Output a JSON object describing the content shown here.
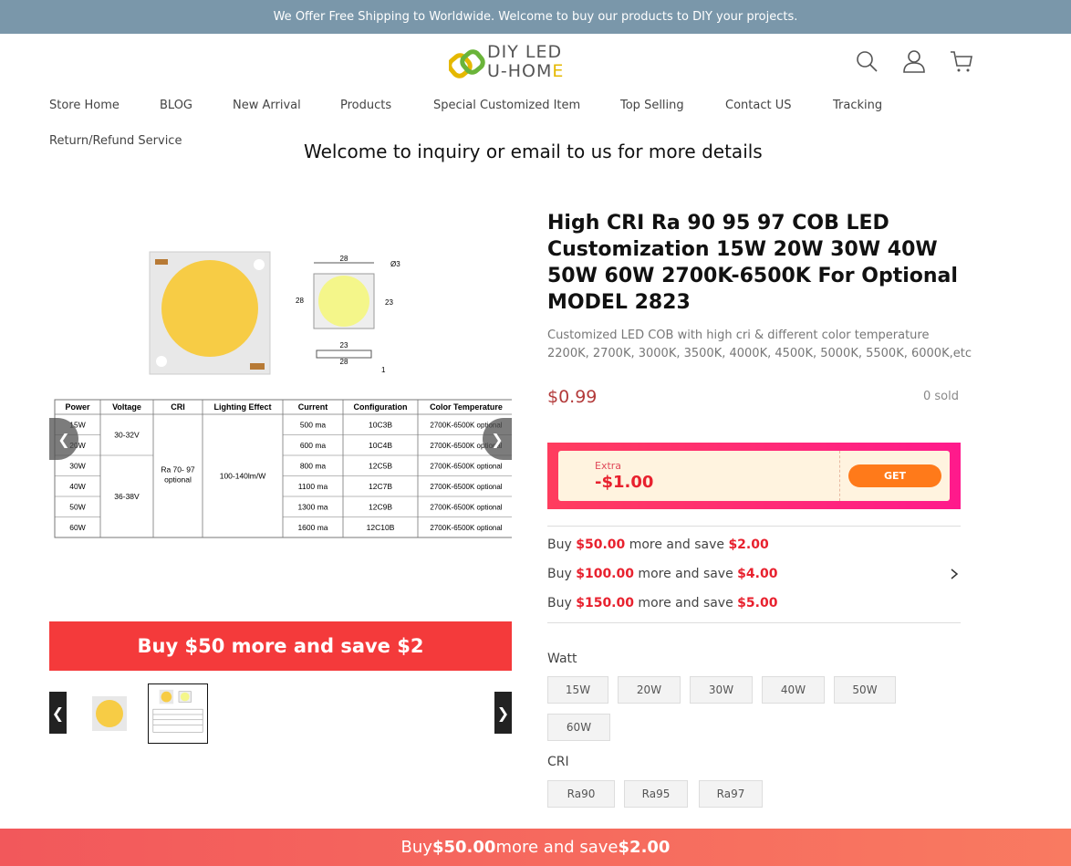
{
  "announcement": "We Offer Free Shipping to Worldwide. Welcome to buy our products to DIY your projects.",
  "logo": {
    "line1": "DIY LED",
    "line2a": "U-HOM",
    "line2b": "E"
  },
  "header_icons": [
    "search-icon",
    "user-icon",
    "cart-icon"
  ],
  "nav": {
    "items": [
      "Store Home",
      "BLOG",
      "New Arrival",
      "Products",
      "Special Customized Item",
      "Top Selling",
      "Contact US",
      "Tracking",
      "Return/Refund Service"
    ]
  },
  "welcome": "Welcome to inquiry or email to us for more details",
  "gallery": {
    "table": {
      "headers": [
        "Power",
        "Voltage",
        "CRI",
        "Lighting Effect",
        "Current",
        "Configuration",
        "Color Temperature"
      ],
      "power": [
        "15W",
        "20W",
        "30W",
        "40W",
        "50W",
        "60W"
      ],
      "voltage": [
        "30-32V",
        "36-38V"
      ],
      "cri": "Ra 70- 97 optional",
      "effect": "100-140lm/W",
      "current": [
        "500 ma",
        "600 ma",
        "800 ma",
        "1100 ma",
        "1300 ma",
        "1600 ma"
      ],
      "config": [
        "10C3B",
        "10C4B",
        "12C5B",
        "12C7B",
        "12C9B",
        "12C10B"
      ],
      "temp": "2700K-6500K optional"
    },
    "dims": {
      "top": "28",
      "side": "28",
      "inner": "23",
      "hole": "Ø3",
      "bottom1": "23",
      "bottom2": "28",
      "thick": "1"
    },
    "banner": "Buy $50 more and save $2"
  },
  "product": {
    "title": "High CRI Ra 90 95 97 COB LED Customization 15W 20W 30W 40W 50W 60W 2700K-6500K For Optional MODEL 2823",
    "subtitle_line1": "Customized LED COB with high cri & different color temperature",
    "subtitle_line2": "2200K, 2700K, 3000K, 3500K, 4000K, 4500K, 5000K, 5500K, 6000K,etc",
    "price": "$0.99",
    "sold": "0 sold"
  },
  "coupon": {
    "label": "Extra",
    "amount": "-$1.00",
    "button": "GET"
  },
  "tiers": [
    {
      "pre": "Buy ",
      "amount": "$50.00",
      "mid": " more and save ",
      "save": "$2.00"
    },
    {
      "pre": "Buy ",
      "amount": "$100.00",
      "mid": " more and save ",
      "save": "$4.00"
    },
    {
      "pre": "Buy ",
      "amount": "$150.00",
      "mid": " more and save ",
      "save": "$5.00"
    }
  ],
  "options": {
    "watt_label": "Watt",
    "watt": [
      "15W",
      "20W",
      "30W",
      "40W",
      "50W",
      "60W"
    ],
    "cri_label": "CRI",
    "cri": [
      "Ra90",
      "Ra95",
      "Ra97"
    ]
  },
  "bottom_bar": {
    "pre": "Buy ",
    "amount": "$50.00",
    "mid": " more and save ",
    "save": "$2.00"
  },
  "colors": {
    "topbar": "#7a97aa",
    "accent_red": "#f43a3b",
    "price": "#b33a3a"
  }
}
